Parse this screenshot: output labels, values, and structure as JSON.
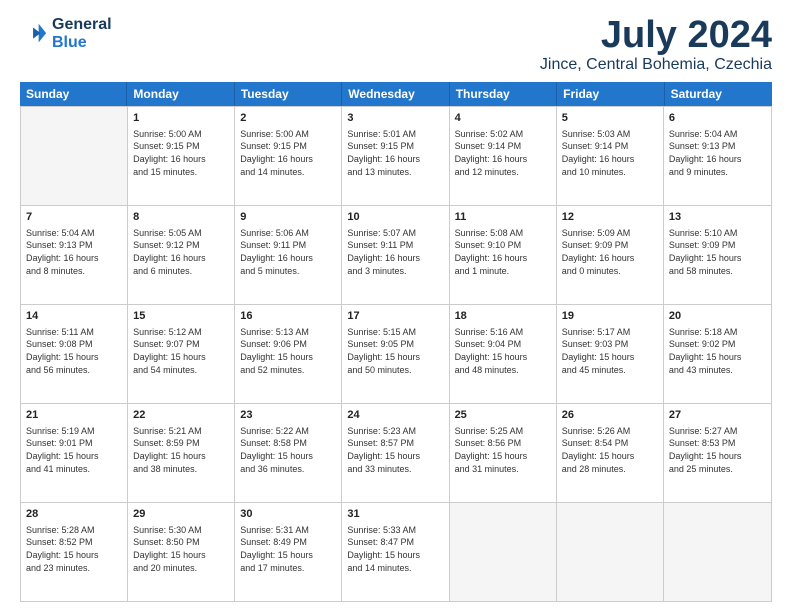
{
  "header": {
    "logo_line1": "General",
    "logo_line2": "Blue",
    "month": "July 2024",
    "location": "Jince, Central Bohemia, Czechia"
  },
  "weekdays": [
    "Sunday",
    "Monday",
    "Tuesday",
    "Wednesday",
    "Thursday",
    "Friday",
    "Saturday"
  ],
  "weeks": [
    [
      {
        "day": "",
        "info": "",
        "empty": true
      },
      {
        "day": "1",
        "info": "Sunrise: 5:00 AM\nSunset: 9:15 PM\nDaylight: 16 hours\nand 15 minutes."
      },
      {
        "day": "2",
        "info": "Sunrise: 5:00 AM\nSunset: 9:15 PM\nDaylight: 16 hours\nand 14 minutes."
      },
      {
        "day": "3",
        "info": "Sunrise: 5:01 AM\nSunset: 9:15 PM\nDaylight: 16 hours\nand 13 minutes."
      },
      {
        "day": "4",
        "info": "Sunrise: 5:02 AM\nSunset: 9:14 PM\nDaylight: 16 hours\nand 12 minutes."
      },
      {
        "day": "5",
        "info": "Sunrise: 5:03 AM\nSunset: 9:14 PM\nDaylight: 16 hours\nand 10 minutes."
      },
      {
        "day": "6",
        "info": "Sunrise: 5:04 AM\nSunset: 9:13 PM\nDaylight: 16 hours\nand 9 minutes."
      }
    ],
    [
      {
        "day": "7",
        "info": "Sunrise: 5:04 AM\nSunset: 9:13 PM\nDaylight: 16 hours\nand 8 minutes."
      },
      {
        "day": "8",
        "info": "Sunrise: 5:05 AM\nSunset: 9:12 PM\nDaylight: 16 hours\nand 6 minutes."
      },
      {
        "day": "9",
        "info": "Sunrise: 5:06 AM\nSunset: 9:11 PM\nDaylight: 16 hours\nand 5 minutes."
      },
      {
        "day": "10",
        "info": "Sunrise: 5:07 AM\nSunset: 9:11 PM\nDaylight: 16 hours\nand 3 minutes."
      },
      {
        "day": "11",
        "info": "Sunrise: 5:08 AM\nSunset: 9:10 PM\nDaylight: 16 hours\nand 1 minute."
      },
      {
        "day": "12",
        "info": "Sunrise: 5:09 AM\nSunset: 9:09 PM\nDaylight: 16 hours\nand 0 minutes."
      },
      {
        "day": "13",
        "info": "Sunrise: 5:10 AM\nSunset: 9:09 PM\nDaylight: 15 hours\nand 58 minutes."
      }
    ],
    [
      {
        "day": "14",
        "info": "Sunrise: 5:11 AM\nSunset: 9:08 PM\nDaylight: 15 hours\nand 56 minutes."
      },
      {
        "day": "15",
        "info": "Sunrise: 5:12 AM\nSunset: 9:07 PM\nDaylight: 15 hours\nand 54 minutes."
      },
      {
        "day": "16",
        "info": "Sunrise: 5:13 AM\nSunset: 9:06 PM\nDaylight: 15 hours\nand 52 minutes."
      },
      {
        "day": "17",
        "info": "Sunrise: 5:15 AM\nSunset: 9:05 PM\nDaylight: 15 hours\nand 50 minutes."
      },
      {
        "day": "18",
        "info": "Sunrise: 5:16 AM\nSunset: 9:04 PM\nDaylight: 15 hours\nand 48 minutes."
      },
      {
        "day": "19",
        "info": "Sunrise: 5:17 AM\nSunset: 9:03 PM\nDaylight: 15 hours\nand 45 minutes."
      },
      {
        "day": "20",
        "info": "Sunrise: 5:18 AM\nSunset: 9:02 PM\nDaylight: 15 hours\nand 43 minutes."
      }
    ],
    [
      {
        "day": "21",
        "info": "Sunrise: 5:19 AM\nSunset: 9:01 PM\nDaylight: 15 hours\nand 41 minutes."
      },
      {
        "day": "22",
        "info": "Sunrise: 5:21 AM\nSunset: 8:59 PM\nDaylight: 15 hours\nand 38 minutes."
      },
      {
        "day": "23",
        "info": "Sunrise: 5:22 AM\nSunset: 8:58 PM\nDaylight: 15 hours\nand 36 minutes."
      },
      {
        "day": "24",
        "info": "Sunrise: 5:23 AM\nSunset: 8:57 PM\nDaylight: 15 hours\nand 33 minutes."
      },
      {
        "day": "25",
        "info": "Sunrise: 5:25 AM\nSunset: 8:56 PM\nDaylight: 15 hours\nand 31 minutes."
      },
      {
        "day": "26",
        "info": "Sunrise: 5:26 AM\nSunset: 8:54 PM\nDaylight: 15 hours\nand 28 minutes."
      },
      {
        "day": "27",
        "info": "Sunrise: 5:27 AM\nSunset: 8:53 PM\nDaylight: 15 hours\nand 25 minutes."
      }
    ],
    [
      {
        "day": "28",
        "info": "Sunrise: 5:28 AM\nSunset: 8:52 PM\nDaylight: 15 hours\nand 23 minutes."
      },
      {
        "day": "29",
        "info": "Sunrise: 5:30 AM\nSunset: 8:50 PM\nDaylight: 15 hours\nand 20 minutes."
      },
      {
        "day": "30",
        "info": "Sunrise: 5:31 AM\nSunset: 8:49 PM\nDaylight: 15 hours\nand 17 minutes."
      },
      {
        "day": "31",
        "info": "Sunrise: 5:33 AM\nSunset: 8:47 PM\nDaylight: 15 hours\nand 14 minutes."
      },
      {
        "day": "",
        "info": "",
        "empty": true
      },
      {
        "day": "",
        "info": "",
        "empty": true
      },
      {
        "day": "",
        "info": "",
        "empty": true
      }
    ]
  ]
}
